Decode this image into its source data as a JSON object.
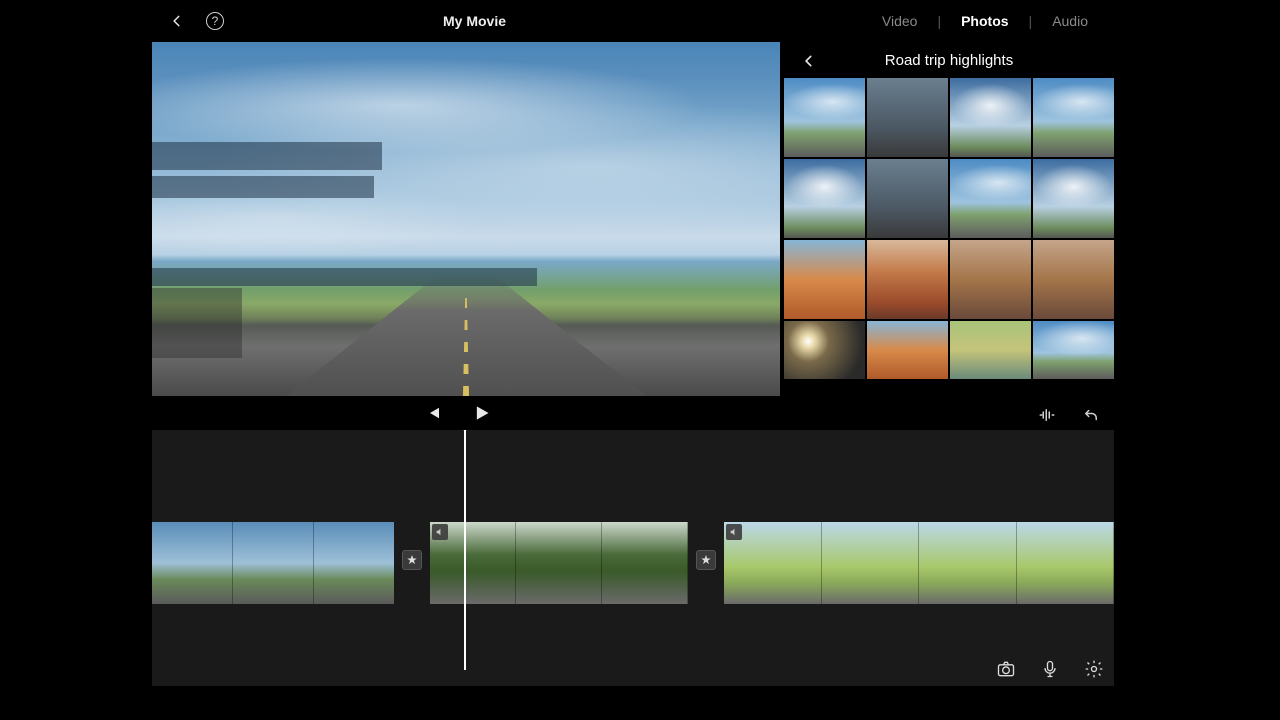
{
  "header": {
    "project_title": "My Movie",
    "tabs": {
      "video": "Video",
      "photos": "Photos",
      "audio": "Audio",
      "active": "photos"
    }
  },
  "media_browser": {
    "album_title": "Road trip highlights",
    "thumbnails": [
      {
        "name": "highway-1",
        "style": "sky"
      },
      {
        "name": "storm-road",
        "style": "storm"
      },
      {
        "name": "big-clouds",
        "style": "clouds"
      },
      {
        "name": "highway-2",
        "style": "sky"
      },
      {
        "name": "sky-road",
        "style": "clouds"
      },
      {
        "name": "overcast-mesa",
        "style": "storm"
      },
      {
        "name": "highway-3",
        "style": "sky"
      },
      {
        "name": "cloud-field",
        "style": "clouds"
      },
      {
        "name": "monument-valley",
        "style": "mesa"
      },
      {
        "name": "red-rocks",
        "style": "rock"
      },
      {
        "name": "desert-brush",
        "style": "canyon"
      },
      {
        "name": "canyon",
        "style": "canyon"
      },
      {
        "name": "sun-flare",
        "style": "sun"
      },
      {
        "name": "arches",
        "style": "mesa"
      },
      {
        "name": "yellow-lake",
        "style": "lake"
      },
      {
        "name": "sky-blue",
        "style": "sky"
      }
    ]
  },
  "timeline": {
    "clips": [
      {
        "name": "clip-highway",
        "style": "sky",
        "frames": 3
      },
      {
        "name": "clip-forest-road",
        "style": "forest",
        "frames": 3,
        "muted": true
      },
      {
        "name": "clip-fields",
        "style": "fields",
        "frames": 4,
        "muted": true
      }
    ],
    "transitions": [
      "star",
      "star"
    ]
  },
  "icons": {
    "back": "back-chevron-icon",
    "help": "help-icon",
    "skip_back": "skip-back-icon",
    "play": "play-icon",
    "audio_wave": "audio-waveform-icon",
    "undo": "undo-icon",
    "camera": "camera-icon",
    "microphone": "microphone-icon",
    "settings": "settings-gear-icon",
    "star": "star-icon",
    "mute": "mute-icon"
  }
}
